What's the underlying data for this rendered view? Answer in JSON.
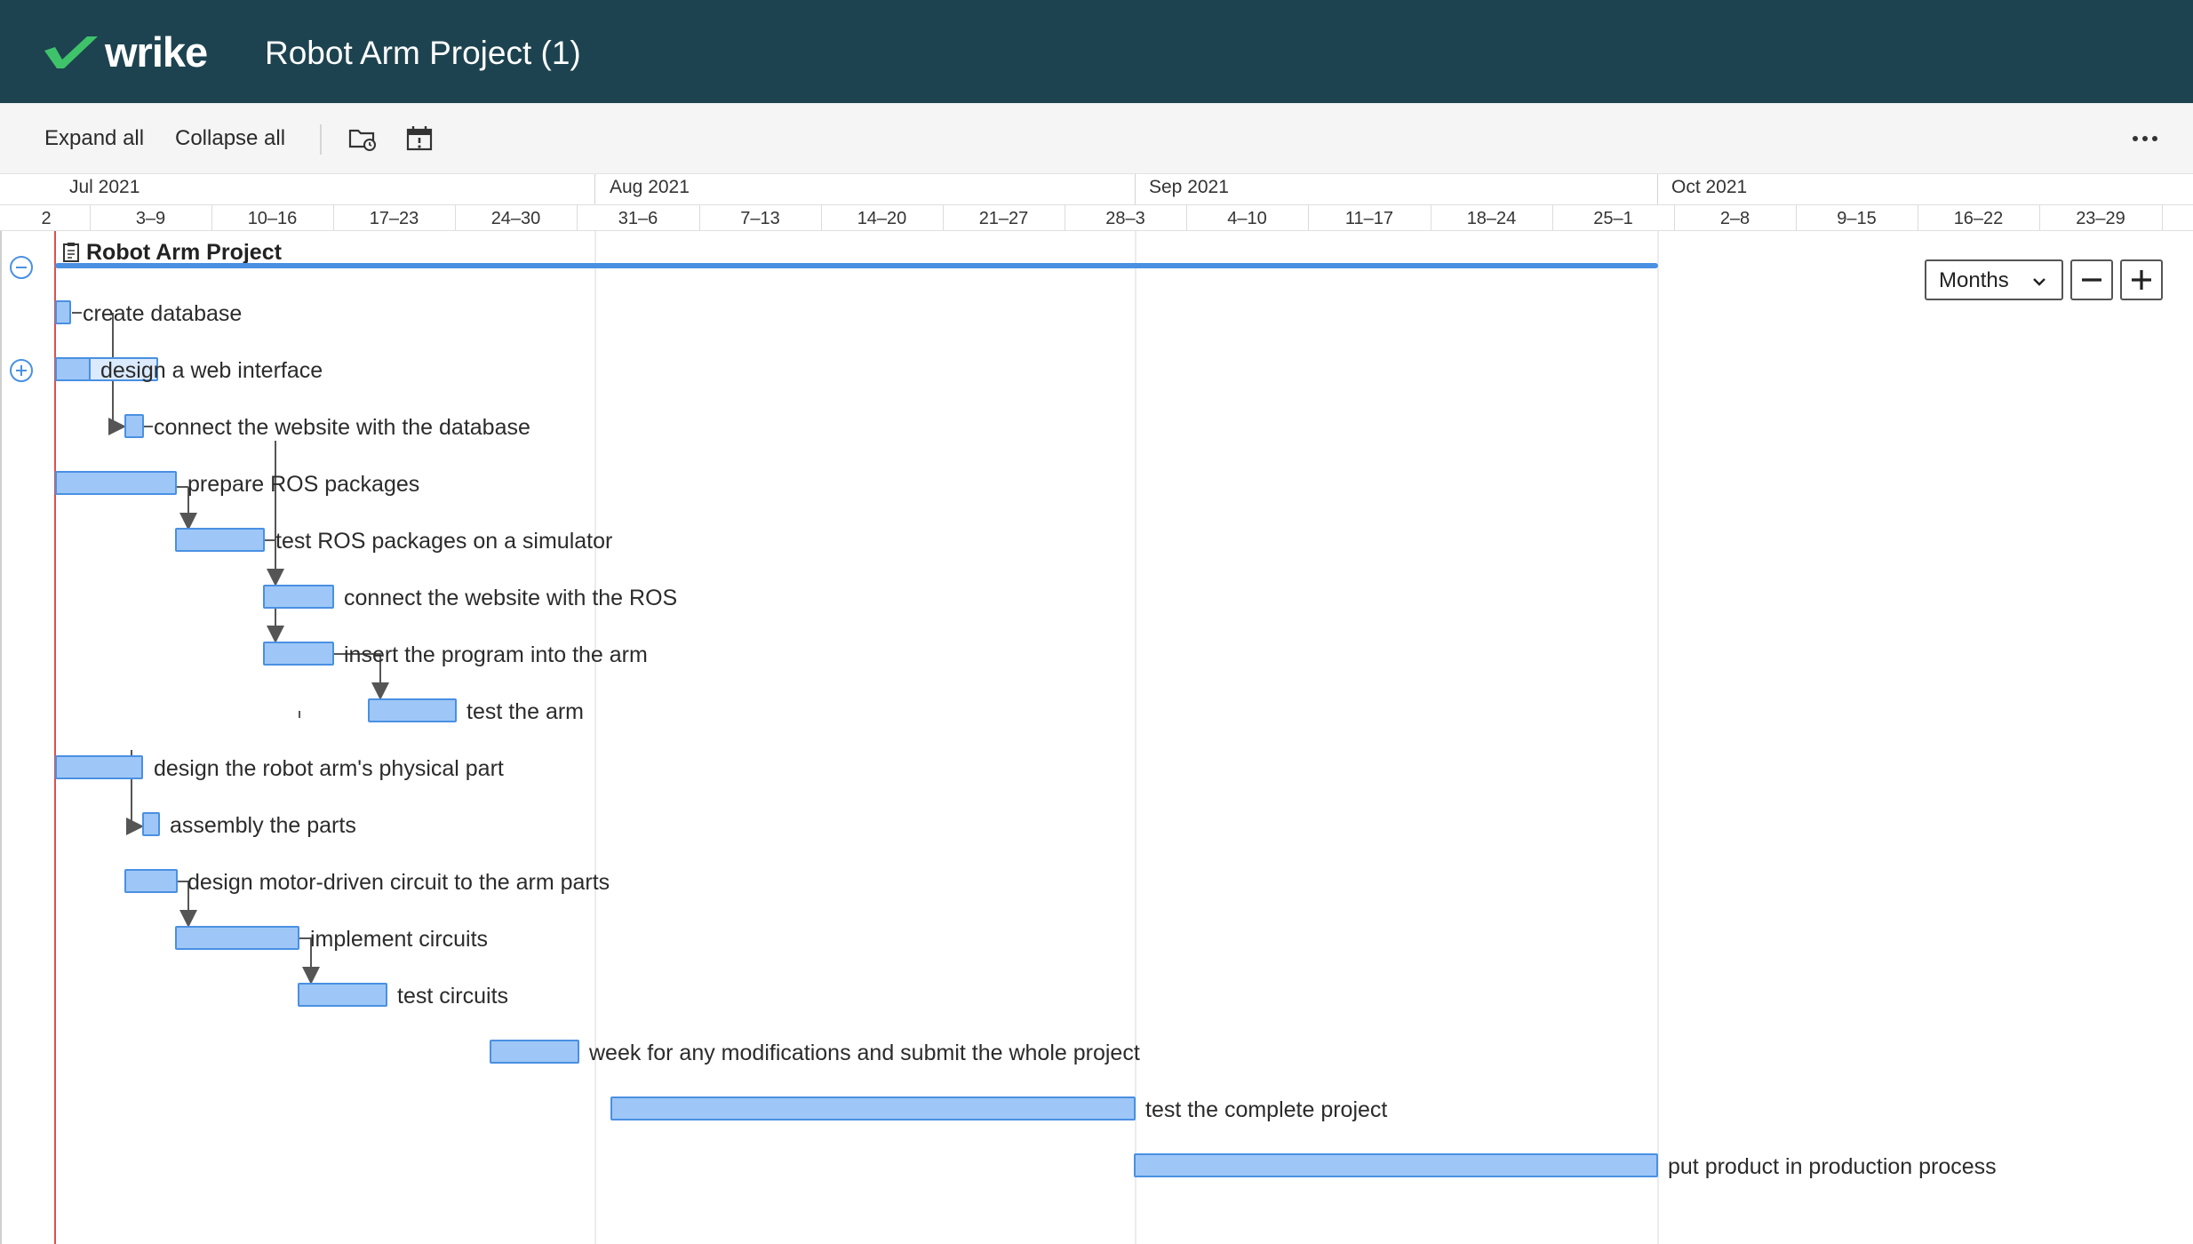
{
  "header": {
    "logo_text": "wrike",
    "project_title": "Robot Arm Project (1)",
    "background_color": "#1d4350",
    "logo_check_color": "#3fc36a"
  },
  "toolbar": {
    "expand_all_label": "Expand all",
    "collapse_all_label": "Collapse all",
    "icons": [
      "folder-icon",
      "calendar-icon",
      "more-icon"
    ]
  },
  "timescale": {
    "months": [
      {
        "label": "Jul 2021"
      },
      {
        "label": "Aug 2021"
      },
      {
        "label": "Sep 2021"
      },
      {
        "label": "Oct 2021"
      }
    ],
    "weeks": [
      "2",
      "3–9",
      "10–16",
      "17–23",
      "24–30",
      "31–6",
      "7–13",
      "14–20",
      "21–27",
      "28–3",
      "4–10",
      "11–17",
      "18–24",
      "25–1",
      "2–8",
      "9–15",
      "16–22",
      "23–29"
    ]
  },
  "gantt": {
    "project_label": "Robot Arm Project",
    "scale": "Months",
    "bar_color": "#9ec7f7",
    "bar_border_color": "#4a90e2",
    "today_line_color": "#d9534f",
    "tasks": [
      {
        "label": "create database"
      },
      {
        "label": "design a web interface"
      },
      {
        "label": "connect the website with the database"
      },
      {
        "label": "prepare ROS packages"
      },
      {
        "label": "test ROS packages on a simulator"
      },
      {
        "label": "connect the website with the ROS"
      },
      {
        "label": "insert the program into the arm"
      },
      {
        "label": "test the arm"
      },
      {
        "label": "design the robot arm's physical part"
      },
      {
        "label": "assembly the parts"
      },
      {
        "label": "design motor-driven circuit to the arm parts"
      },
      {
        "label": "implement circuits"
      },
      {
        "label": "test circuits"
      },
      {
        "label": "week for any modifications and submit the whole project"
      },
      {
        "label": "test the complete project"
      },
      {
        "label": "put product in production process"
      }
    ]
  }
}
